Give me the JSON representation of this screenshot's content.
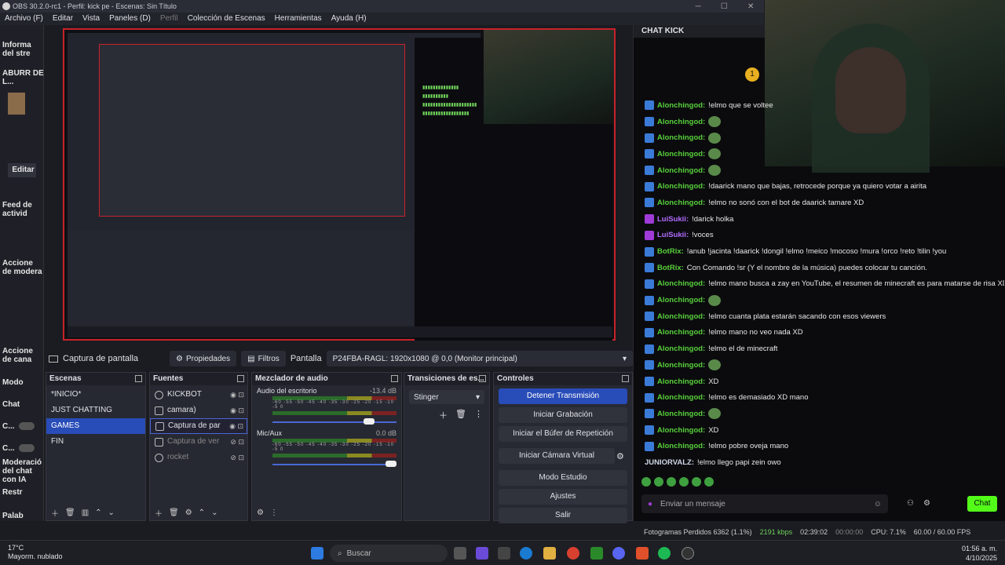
{
  "window": {
    "title": "OBS 30.2.0-rc1 - Perfil: kick pe - Escenas: Sin Título"
  },
  "menu": [
    "Archivo (F)",
    "Editar",
    "Vista",
    "Paneles (D)",
    "Perfil",
    "Colección de Escenas",
    "Herramientas",
    "Ayuda (H)"
  ],
  "left_docks": {
    "info": "Informa del stre",
    "aburr": "ABURR DE L...",
    "editar": "Editar",
    "feed": "Feed de activid",
    "acciones_mod": "Accione de modera",
    "acciones_cana": "Accione de cana",
    "modo": "Modo",
    "chat": "Chat",
    "c1": "C...",
    "c2": "C...",
    "moderacion": "Moderació del chat con IA",
    "restr": "Restr",
    "palab": "Palab"
  },
  "source_bar": {
    "current": "Captura de pantalla",
    "properties": "Propiedades",
    "filters": "Filtros",
    "screen_label": "Pantalla",
    "monitor": "P24FBA-RAGL: 1920x1080 @ 0,0 (Monitor principal)"
  },
  "scenes": {
    "title": "Escenas",
    "items": [
      "*INICIO*",
      "JUST CHATTING",
      "GAMES",
      "FIN"
    ],
    "selected": 2
  },
  "sources": {
    "title": "Fuentes",
    "items": [
      "KICKBOT",
      "camara)",
      "Captura de par",
      "Captura de ver",
      "rocket"
    ],
    "selected": 2
  },
  "mixer": {
    "title": "Mezclador de audio",
    "channels": [
      {
        "name": "Audio del escritorio",
        "db": "-13.4 dB",
        "level": 0.82
      },
      {
        "name": "Mic/Aux",
        "db": "0.0 dB",
        "level": 1.0
      }
    ],
    "scale": "-60 -55 -50 -45 -40 -35 -30 -25 -20 -15 -10 -5 0"
  },
  "transitions": {
    "title": "Transiciones de es...",
    "selected": "Stinger"
  },
  "controls": {
    "title": "Controles",
    "buttons": [
      "Detener Transmisión",
      "Iniciar Grabación",
      "Iniciar el Búfer de Repetición",
      "Iniciar Cámara Virtual",
      "Modo Estudio",
      "Ajustes",
      "Salir"
    ]
  },
  "chat": {
    "title": "CHAT KICK",
    "messages": [
      {
        "user": "Alonchingod:",
        "text": "!elmo que se voltee",
        "type": "k"
      },
      {
        "user": "Alonchingod:",
        "text": "",
        "type": "k",
        "emote": true
      },
      {
        "user": "Alonchingod:",
        "text": "",
        "type": "k",
        "emote": true
      },
      {
        "user": "Alonchingod:",
        "text": "",
        "type": "k",
        "emote": true
      },
      {
        "user": "Alonchingod:",
        "text": "",
        "type": "k",
        "emote": true
      },
      {
        "user": "Alonchingod:",
        "text": "!daarick mano que bajas, retrocede porque ya quiero votar a airita",
        "type": "k"
      },
      {
        "user": "Alonchingod:",
        "text": "!elmo no sonó con el bot de daarick tamare XD",
        "type": "k"
      },
      {
        "user": "LuiSukii:",
        "text": "!darick holka",
        "type": "p"
      },
      {
        "user": "LuiSukii:",
        "text": "!voces",
        "type": "p"
      },
      {
        "user": "BotRix:",
        "text": "!anub !jacinta !daarick !dongil !elmo !meico !mocoso !mura !orco !reto !tilin !you",
        "type": "k"
      },
      {
        "user": "BotRix:",
        "text": "Con Comando !sr (Y el nombre de la música) puedes colocar tu canción.",
        "type": "k"
      },
      {
        "user": "Alonchingod:",
        "text": "!elmo mano busca a zay en YouTube, el resumen de minecraft es para matarse de risa XD",
        "type": "k"
      },
      {
        "user": "Alonchingod:",
        "text": "",
        "type": "k",
        "emote": true
      },
      {
        "user": "Alonchingod:",
        "text": "!elmo cuanta plata estarán sacando con esos viewers",
        "type": "k"
      },
      {
        "user": "Alonchingod:",
        "text": "!elmo mano no veo nada XD",
        "type": "k"
      },
      {
        "user": "Alonchingod:",
        "text": "!elmo el de minecraft",
        "type": "k"
      },
      {
        "user": "Alonchingod:",
        "text": "",
        "type": "k",
        "emote": true
      },
      {
        "user": "Alonchingod:",
        "text": "XD",
        "type": "k"
      },
      {
        "user": "Alonchingod:",
        "text": "!elmo es demasiado XD mano",
        "type": "k"
      },
      {
        "user": "Alonchingod:",
        "text": "",
        "type": "k",
        "emote": true
      },
      {
        "user": "Alonchingod:",
        "text": "XD",
        "type": "k"
      },
      {
        "user": "Alonchingod:",
        "text": "!elmo pobre oveja mano",
        "type": "k"
      },
      {
        "user": "JUNIORVALZ:",
        "text": "!elmo llego papi zein owo",
        "type": "n"
      }
    ],
    "input_placeholder": "Enviar un mensaje",
    "send": "Chat"
  },
  "status": {
    "dropped": "Fotogramas Perdidos 6362 (1.1%)",
    "kbps": "2191 kbps",
    "live": "02:39:02",
    "rec": "00:00:00",
    "cpu": "CPU: 7.1%",
    "fps": "60.00 / 60.00 FPS"
  },
  "taskbar": {
    "temp": "17°C",
    "weather": "Mayorm. nublado",
    "search": "Buscar",
    "time": "01:56 a. m.",
    "date": "4/10/2025"
  }
}
